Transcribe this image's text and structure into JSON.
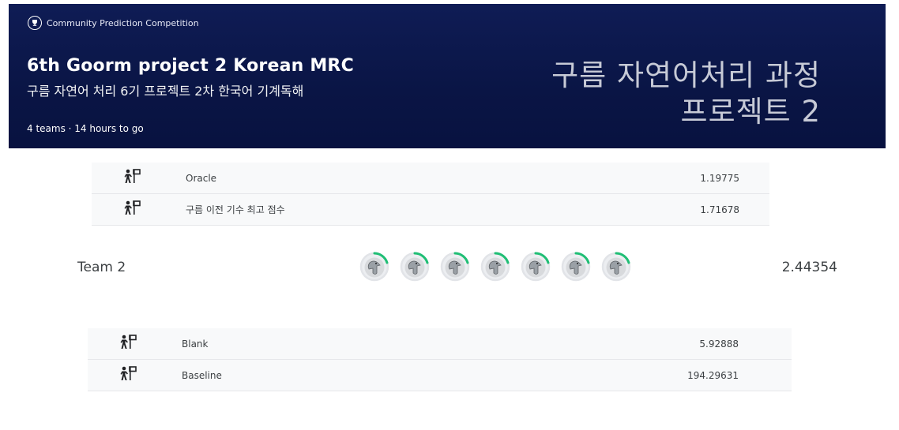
{
  "header": {
    "competition_type": "Community Prediction Competition",
    "title": "6th Goorm project 2 Korean MRC",
    "subtitle": "구름 자연어 처리 6기 프로젝트 2차 한국어 기계독해",
    "meta": "4 teams · 14 hours to go",
    "banner_line1": "구름 자연어처리 과정",
    "banner_line2": "프로젝트 2"
  },
  "benchmarks_top": [
    {
      "name": "Oracle",
      "score": "1.19775",
      "icon": "benchmark-icon"
    },
    {
      "name": "구름 이전 기수 최고 점수",
      "score": "1.71678",
      "icon": "benchmark-icon"
    }
  ],
  "team": {
    "name": "Team 2",
    "score": "2.44354",
    "member_count": 7,
    "avatar_icon": "default-avatar-icon",
    "ring_color": "#20BE75"
  },
  "benchmarks_bottom": [
    {
      "name": "Blank",
      "score": "5.92888",
      "icon": "benchmark-icon"
    },
    {
      "name": "Baseline",
      "score": "194.29631",
      "icon": "benchmark-icon"
    }
  ],
  "colors": {
    "banner": "#0d1a4f",
    "row_bg": "#f8f9fa",
    "accent_ring": "#20BE75"
  }
}
